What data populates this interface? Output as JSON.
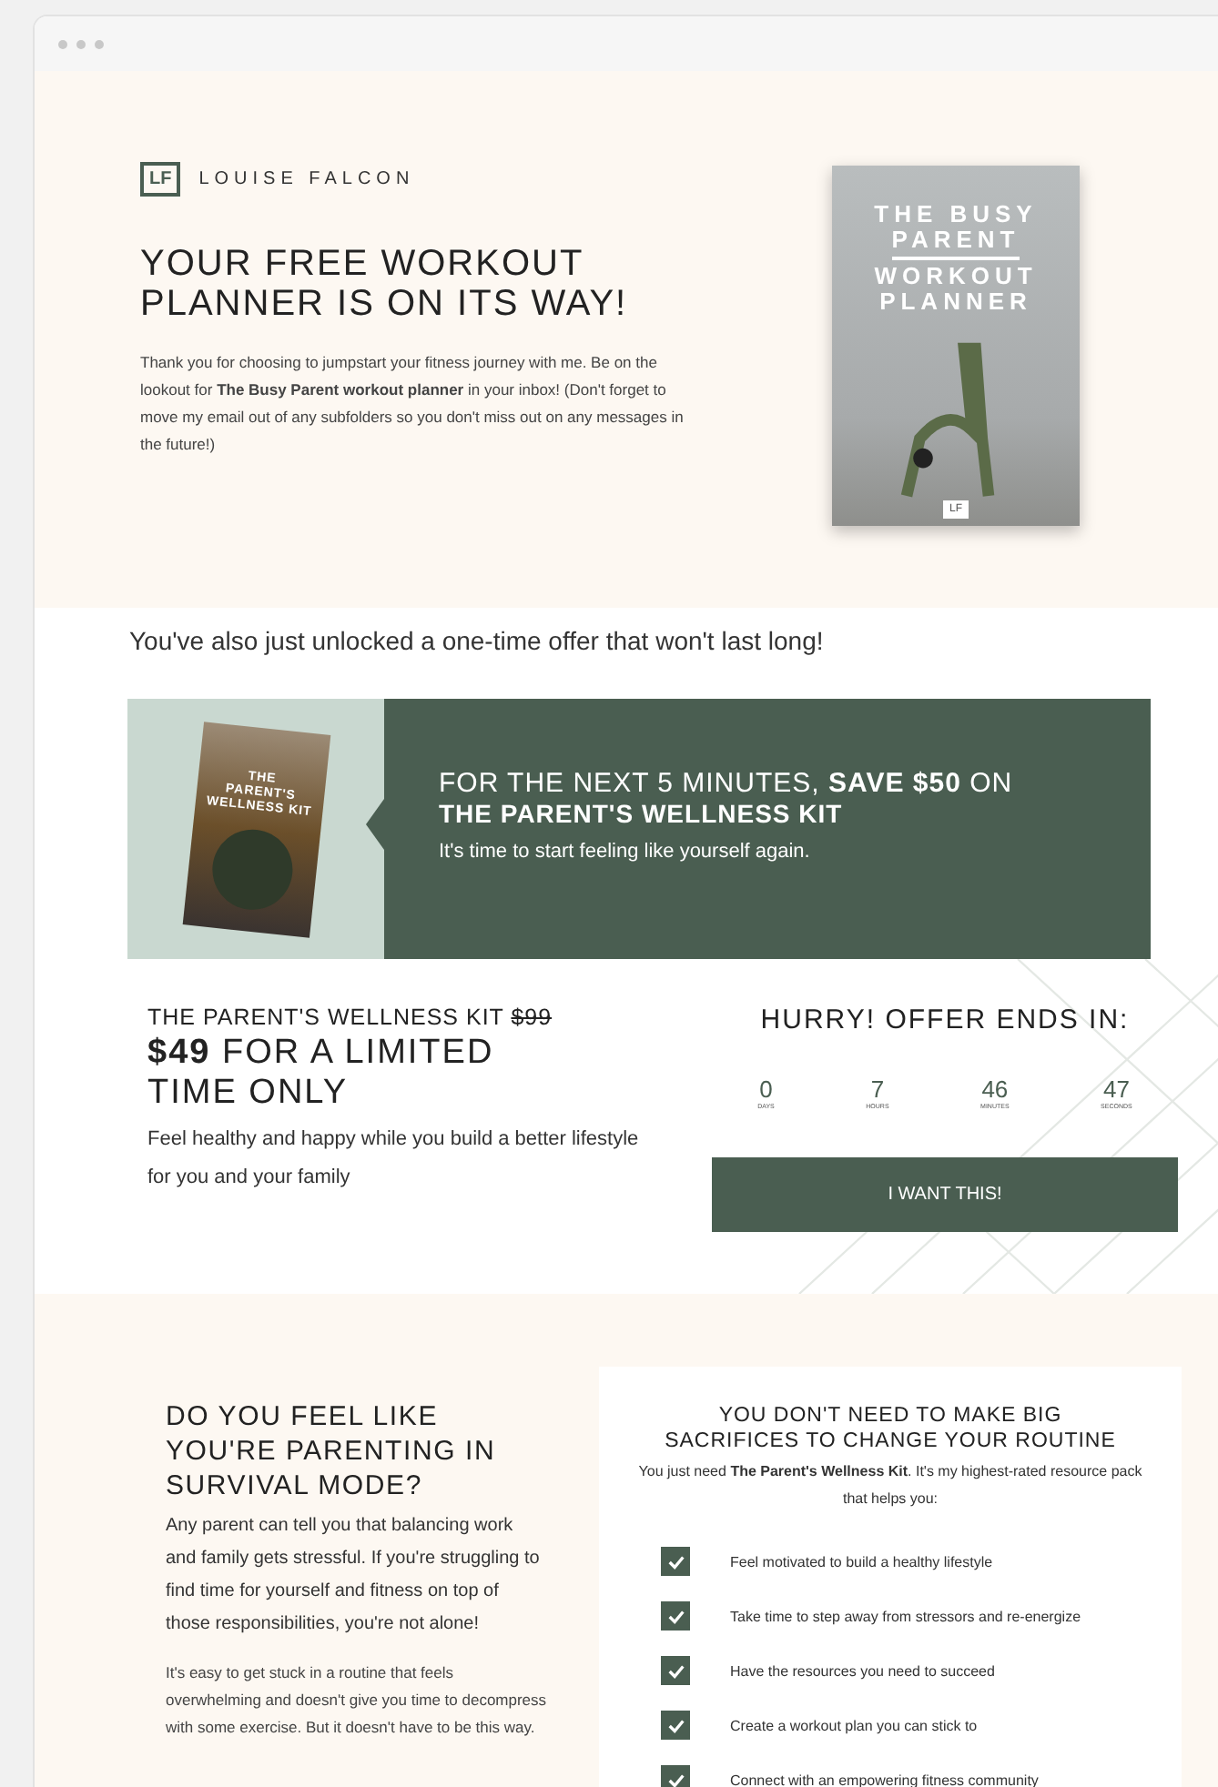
{
  "brand": {
    "name": "LOUISE FALCON",
    "logo": "LF"
  },
  "hero": {
    "title": "YOUR FREE WORKOUT PLANNER IS ON ITS WAY!",
    "text": "Thank you for choosing to jumpstart your fitness journey with me. Be on the lookout for **The Busy Parent workout planner** in your inbox! (Don't forget to move my email out of any subfolders so you don't miss out on any messages in the future!)",
    "cover_lines": [
      "THE BUSY",
      "PARENT",
      "WORKOUT",
      "PLANNER"
    ],
    "cover_logo": "LF"
  },
  "offer_intro": "You've also just unlocked a one-time offer that won't last long!",
  "banner": {
    "cover_lines": [
      "THE",
      "PARENT'S",
      "WELLNESS KIT"
    ],
    "headline": "FOR THE NEXT 5 MINUTES, **SAVE $50** ON",
    "headline_2": "THE PARENT'S WELLNESS KIT",
    "subtitle": "It's time to start feeling like yourself again."
  },
  "price": {
    "product": "THE PARENT'S WELLNESS KIT",
    "old_price": "$99",
    "new_price": "$49",
    "tagline": "FOR A LIMITED TIME ONLY",
    "description": "Feel healthy and happy while you build a better lifestyle for you and your family"
  },
  "countdown": {
    "title": "HURRY! OFFER ENDS IN:",
    "units": [
      {
        "value": "0",
        "label": "DAYS"
      },
      {
        "value": "7",
        "label": "HOURS"
      },
      {
        "value": "46",
        "label": "MINUTES"
      },
      {
        "value": "47",
        "label": "SECONDS"
      }
    ],
    "button": "I WANT THIS!"
  },
  "survival": {
    "title": "DO YOU FEEL LIKE YOU'RE PARENTING IN SURVIVAL MODE?",
    "lead": "Any parent can tell you that balancing work and family gets stressful. If you're struggling to find time for yourself and fitness on top of those responsibilities, you're not alone!",
    "text": "It's easy to get stuck in a routine that feels overwhelming and doesn't give you time to decompress with some exercise. But it doesn't have to be this way."
  },
  "benefits": {
    "title": "YOU DON'T NEED TO MAKE BIG SACRIFICES TO CHANGE YOUR ROUTINE",
    "intro": "You just need **The Parent's Wellness Kit**. It's my highest-rated resource pack that helps you:",
    "items": [
      {
        "text": "Feel motivated to build a healthy lifestyle",
        "checked": true
      },
      {
        "text": "Take time to step away from stressors and re-energize",
        "checked": true
      },
      {
        "text": "Have the resources you need to succeed",
        "checked": true
      },
      {
        "text": "Create a workout plan you can stick to",
        "checked": true
      },
      {
        "text": "Connect with an empowering fitness community",
        "checked": true
      }
    ]
  }
}
